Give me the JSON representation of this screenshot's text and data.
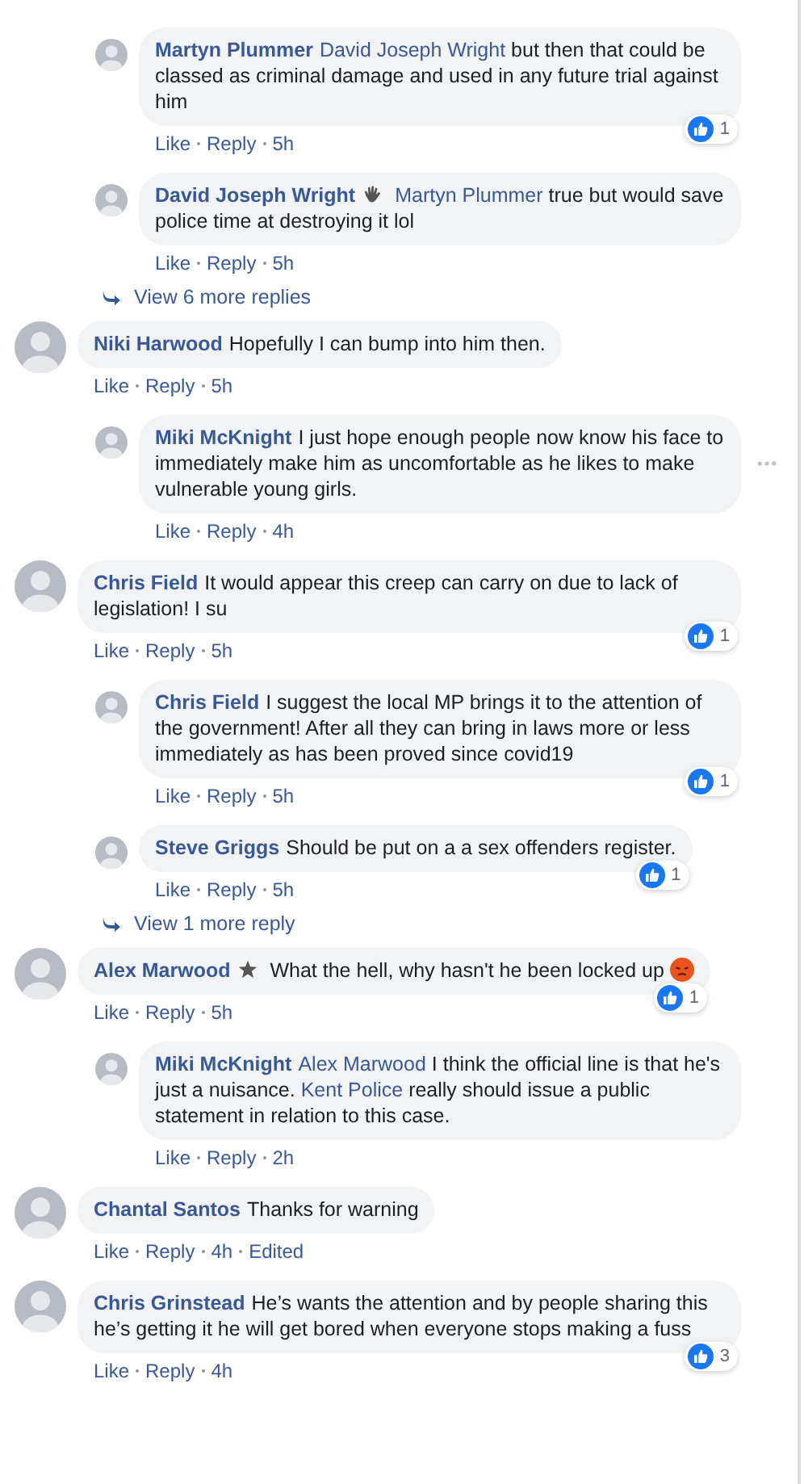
{
  "threads": [
    {
      "replies": [
        {
          "author": "Martyn Plummer",
          "body": [
            {
              "kind": "mention",
              "text": "David Joseph Wright"
            },
            {
              "kind": "text",
              "text": "but then that could be classed as criminal damage and used in any future trial against him"
            }
          ],
          "meta": {
            "like": "Like",
            "reply": "Reply",
            "time": "5h"
          },
          "reactions": "1"
        },
        {
          "author": "David Joseph Wright",
          "body": [
            {
              "kind": "badge_hand"
            },
            {
              "kind": "mention",
              "text": "Martyn Plummer"
            },
            {
              "kind": "text",
              "text": "true but would save police time at destroying it lol"
            }
          ],
          "meta": {
            "like": "Like",
            "reply": "Reply",
            "time": "5h"
          }
        }
      ],
      "more": "View 6 more replies"
    },
    {
      "comment": {
        "author": "Niki Harwood",
        "body": [
          {
            "kind": "text",
            "text": "Hopefully I can bump into him then."
          }
        ],
        "meta": {
          "like": "Like",
          "reply": "Reply",
          "time": "5h"
        }
      },
      "replies": [
        {
          "author": "Miki McKnight",
          "menu_shown": true,
          "body": [
            {
              "kind": "text",
              "text": "I just hope enough people now know his face to immediately make him as uncomfortable as he likes to make vulnerable young girls."
            }
          ],
          "meta": {
            "like": "Like",
            "reply": "Reply",
            "time": "4h"
          }
        }
      ]
    },
    {
      "comment": {
        "author": "Chris Field",
        "body": [
          {
            "kind": "text",
            "text": "It would appear this creep can carry on due to lack of legislation! I su"
          }
        ],
        "meta": {
          "like": "Like",
          "reply": "Reply",
          "time": "5h"
        },
        "reactions": "1"
      },
      "replies": [
        {
          "author": "Chris Field",
          "body": [
            {
              "kind": "text",
              "text": "I suggest the local MP brings it to the attention of the government! After all they can bring in laws more or less immediately as has been proved since covid19"
            }
          ],
          "meta": {
            "like": "Like",
            "reply": "Reply",
            "time": "5h"
          },
          "reactions": "1"
        },
        {
          "author": "Steve Griggs",
          "body": [
            {
              "kind": "text",
              "text": "Should be put on a a sex offenders register."
            }
          ],
          "meta": {
            "like": "Like",
            "reply": "Reply",
            "time": "5h"
          },
          "reactions": "1"
        }
      ],
      "more": "View 1 more reply"
    },
    {
      "comment": {
        "author": "Alex Marwood",
        "body": [
          {
            "kind": "badge_star"
          },
          {
            "kind": "text",
            "text": "What the hell, why hasn't he been locked up"
          },
          {
            "kind": "emoji_angry"
          }
        ],
        "meta": {
          "like": "Like",
          "reply": "Reply",
          "time": "5h"
        },
        "reactions": "1"
      },
      "replies": [
        {
          "author": "Miki McKnight",
          "body": [
            {
              "kind": "mention",
              "text": "Alex Marwood"
            },
            {
              "kind": "text",
              "text": "I think the official line is that he's just a nuisance."
            },
            {
              "kind": "mention",
              "text": "Kent Police"
            },
            {
              "kind": "text",
              "text": "really should issue a public statement in relation to this case."
            }
          ],
          "meta": {
            "like": "Like",
            "reply": "Reply",
            "time": "2h"
          }
        }
      ]
    },
    {
      "comment": {
        "author": "Chantal Santos",
        "body": [
          {
            "kind": "text",
            "text": "Thanks for warning"
          }
        ],
        "meta": {
          "like": "Like",
          "reply": "Reply",
          "time": "4h",
          "edited": "Edited"
        }
      }
    },
    {
      "comment": {
        "author": "Chris Grinstead",
        "body": [
          {
            "kind": "text",
            "text": "He’s wants the attention and by people sharing this he’s getting it he will get bored when everyone stops making a fuss"
          }
        ],
        "meta": {
          "like": "Like",
          "reply": "Reply",
          "time": "4h"
        },
        "reactions": "3"
      }
    }
  ]
}
